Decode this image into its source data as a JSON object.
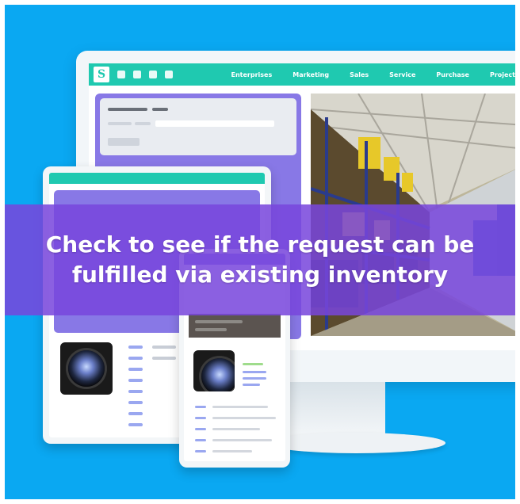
{
  "nav": {
    "logo": "S",
    "links": [
      "Enterprises",
      "Marketing",
      "Sales",
      "Service",
      "Purchase",
      "Project"
    ]
  },
  "banner": {
    "line1": "Check to see if the request can be",
    "line2": "fulfilled via existing inventory"
  },
  "colors": {
    "background": "#0aa8f2",
    "nav_teal": "#1fc9b0",
    "panel_purple": "#8878e6",
    "banner_overlay": "#7846dc"
  },
  "icons": [
    "user-icon",
    "building-icon",
    "person-icon",
    "document-icon",
    "camera-lens-icon"
  ]
}
